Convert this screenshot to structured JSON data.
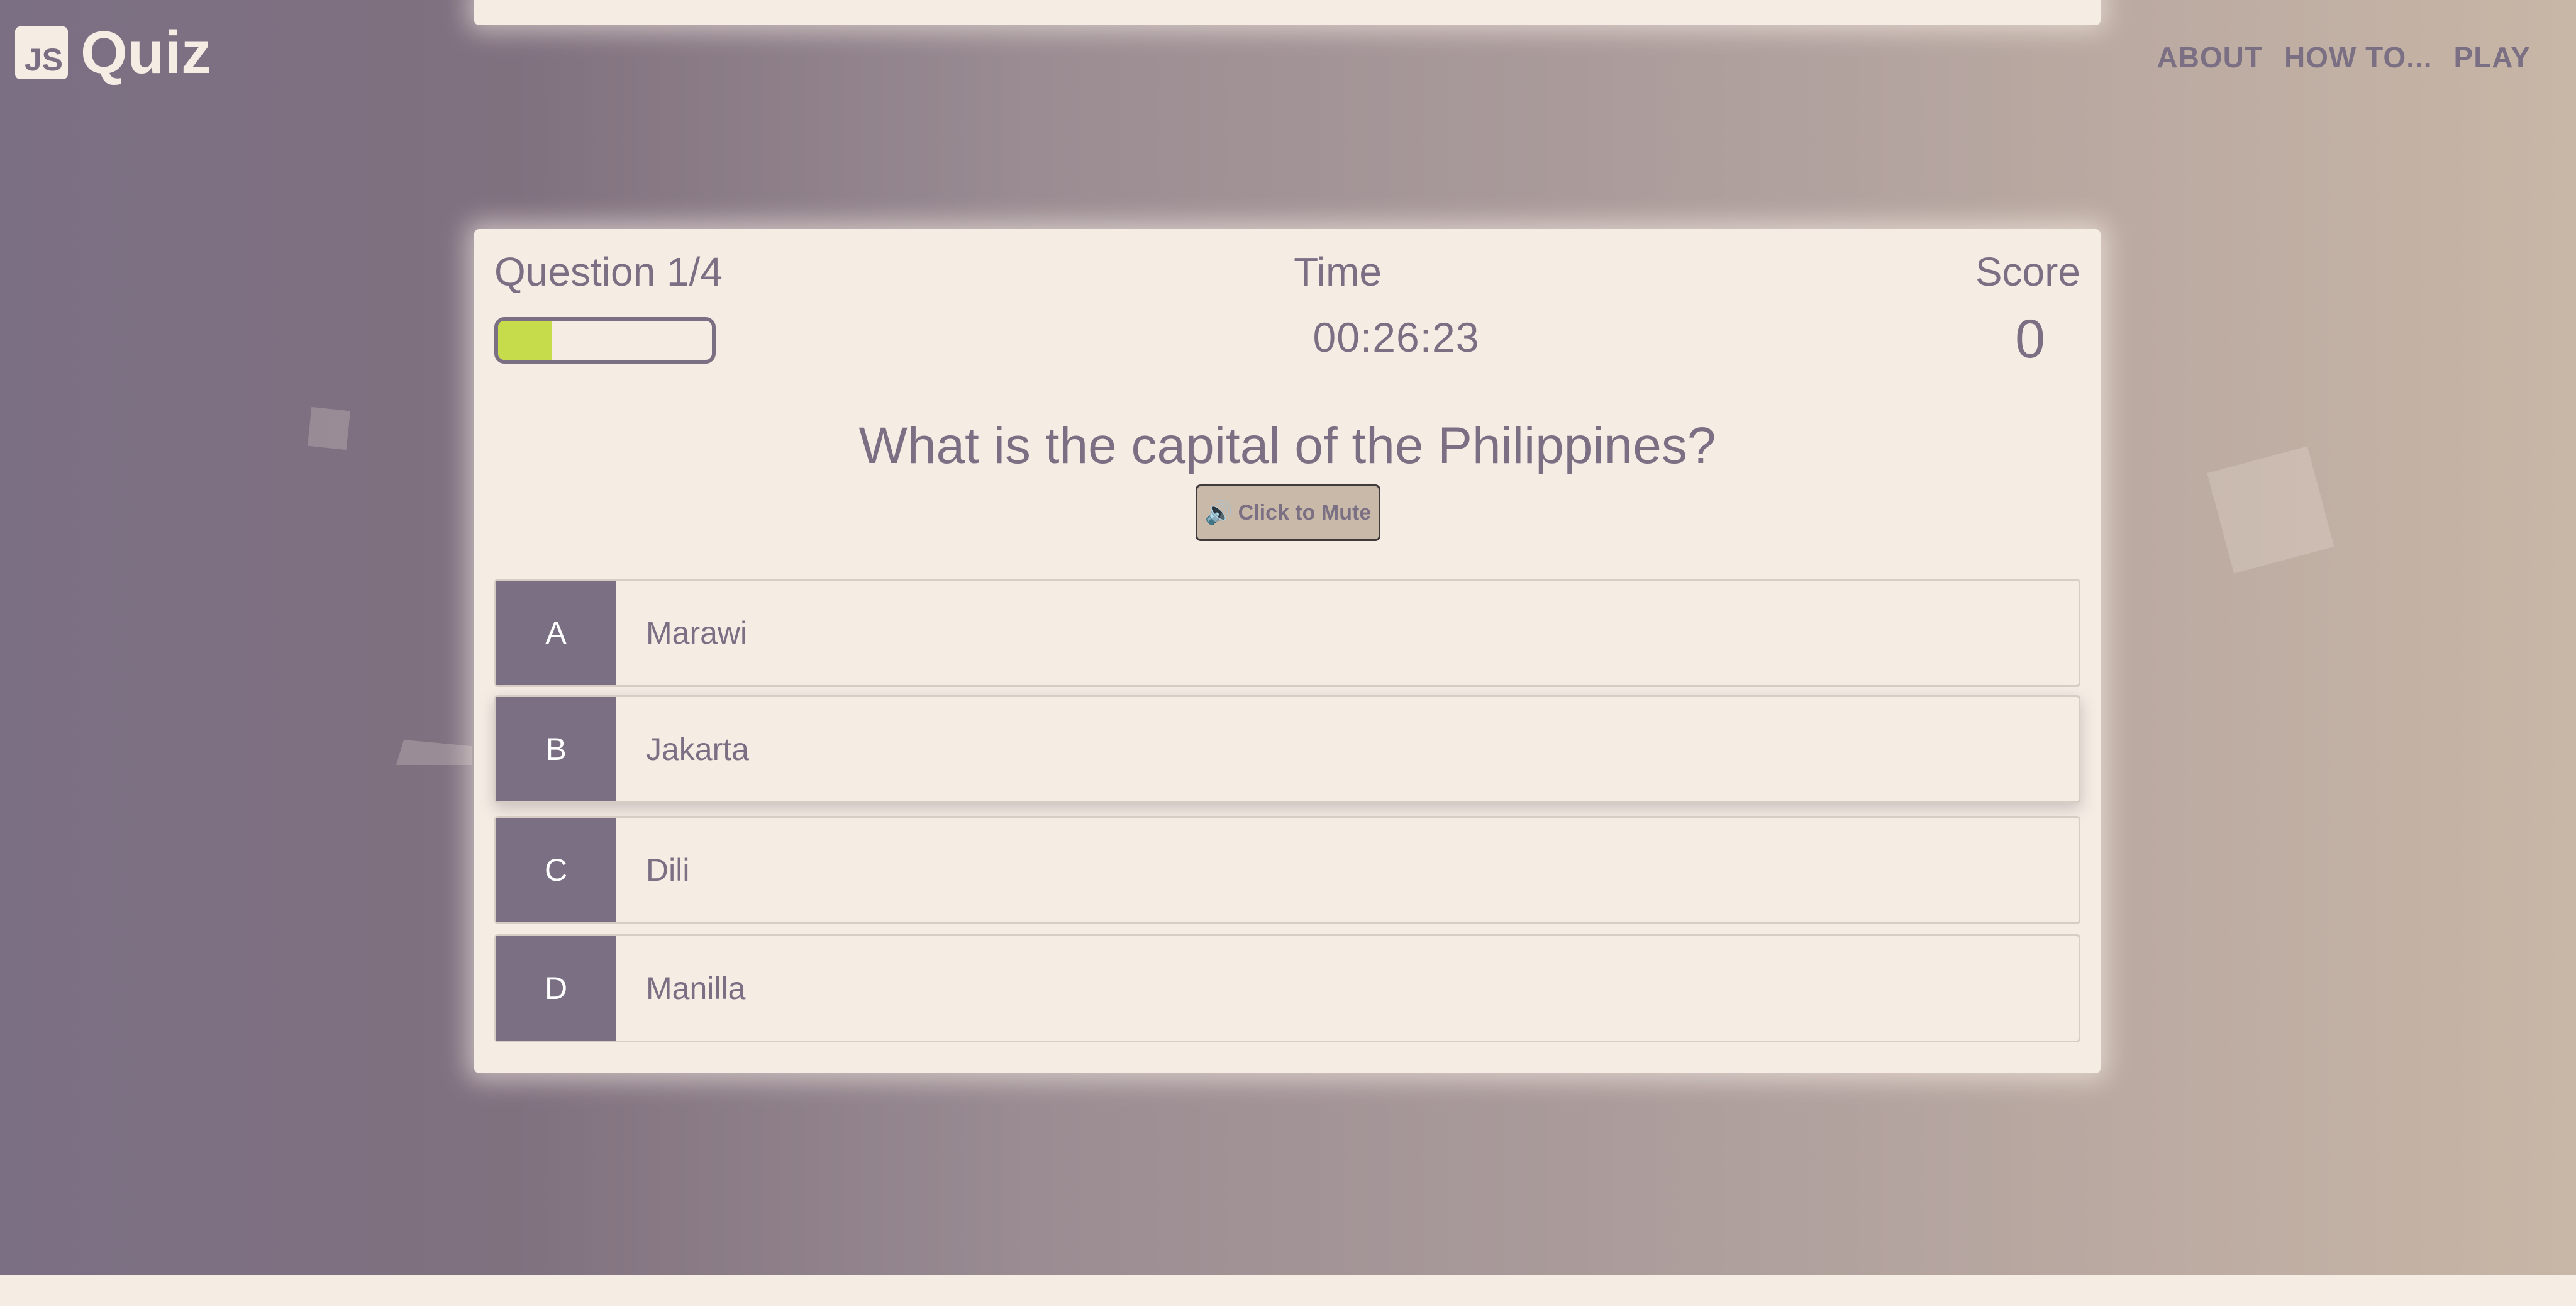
{
  "colors": {
    "primary": "#7b6f84",
    "card_background": "#f5ece4",
    "progress_fill": "#c7dc4a",
    "mute_button": "#c9b9a8"
  },
  "header": {
    "logo_badge": "JS",
    "logo_text": "Quiz",
    "nav": [
      "ABOUT",
      "HOW TO...",
      "PLAY"
    ]
  },
  "hud": {
    "question_label": "Question 1/4",
    "progress_fraction": 0.25,
    "time_label": "Time",
    "time_value": "00:26:23",
    "score_label": "Score",
    "score_value": "0"
  },
  "question": {
    "text": "What is the capital of the Philippines?",
    "mute_label": "Click to Mute",
    "mute_icon": "speaker-icon"
  },
  "choices": [
    {
      "prefix": "A",
      "text": "Marawi"
    },
    {
      "prefix": "B",
      "text": "Jakarta"
    },
    {
      "prefix": "C",
      "text": "Dili"
    },
    {
      "prefix": "D",
      "text": "Manilla"
    }
  ]
}
